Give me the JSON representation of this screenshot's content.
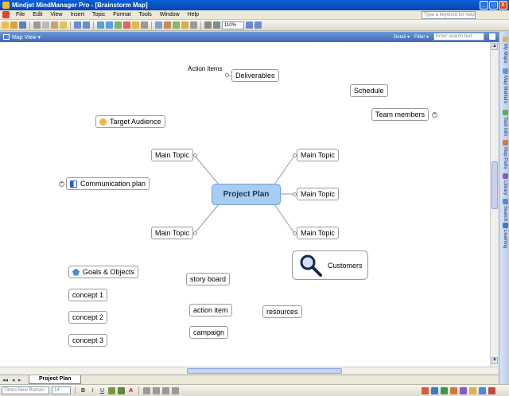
{
  "window": {
    "title": "Mindjet MindManager Pro - [Brainstorm Map]",
    "minimize": "_",
    "maximize": "□",
    "close": "X"
  },
  "menu": {
    "items": [
      "File",
      "Edit",
      "View",
      "Insert",
      "Topic",
      "Format",
      "Tools",
      "Window",
      "Help"
    ],
    "help_placeholder": "Type a keyword for help"
  },
  "toolbar": {
    "zoom": "110%"
  },
  "mapview": {
    "title": "Map View ▾",
    "detail": "Detail ▾",
    "filter": "Filter ▾",
    "search_placeholder": "Enter search text"
  },
  "map": {
    "central": "Project Plan",
    "main_topics": [
      "Main Topic",
      "Main Topic",
      "Main Topic",
      "Main Topic",
      "Main Topic",
      "Main Topic"
    ],
    "floating": {
      "action_items": "Action items",
      "deliverables": "Deliverables",
      "schedule": "Schedule",
      "team_members": "Team members",
      "target_audience": "Target Audience",
      "communication_plan": "Communication plan",
      "customers": "Customers",
      "goals": "Goals & Objects",
      "concept1": "concept 1",
      "concept2": "concept 2",
      "concept3": "concept 3",
      "story_board": "story board",
      "action_item": "action item",
      "campaign": "campaign",
      "resources": "resources"
    }
  },
  "tabs": {
    "active": "Project Plan",
    "nav_first": "◂◂",
    "nav_prev": "◂",
    "nav_next": "▸"
  },
  "format": {
    "font": "Times New Roman",
    "size": "14"
  },
  "side_panel": [
    "My Maps",
    "Map Markers",
    "Task Info",
    "Map Parts",
    "Library",
    "Search",
    "Learning"
  ],
  "colors": {
    "central_fill": "#a8cdf3",
    "titlebar": "#0a5fd8",
    "mapview_bar": "#3e6bb8"
  }
}
